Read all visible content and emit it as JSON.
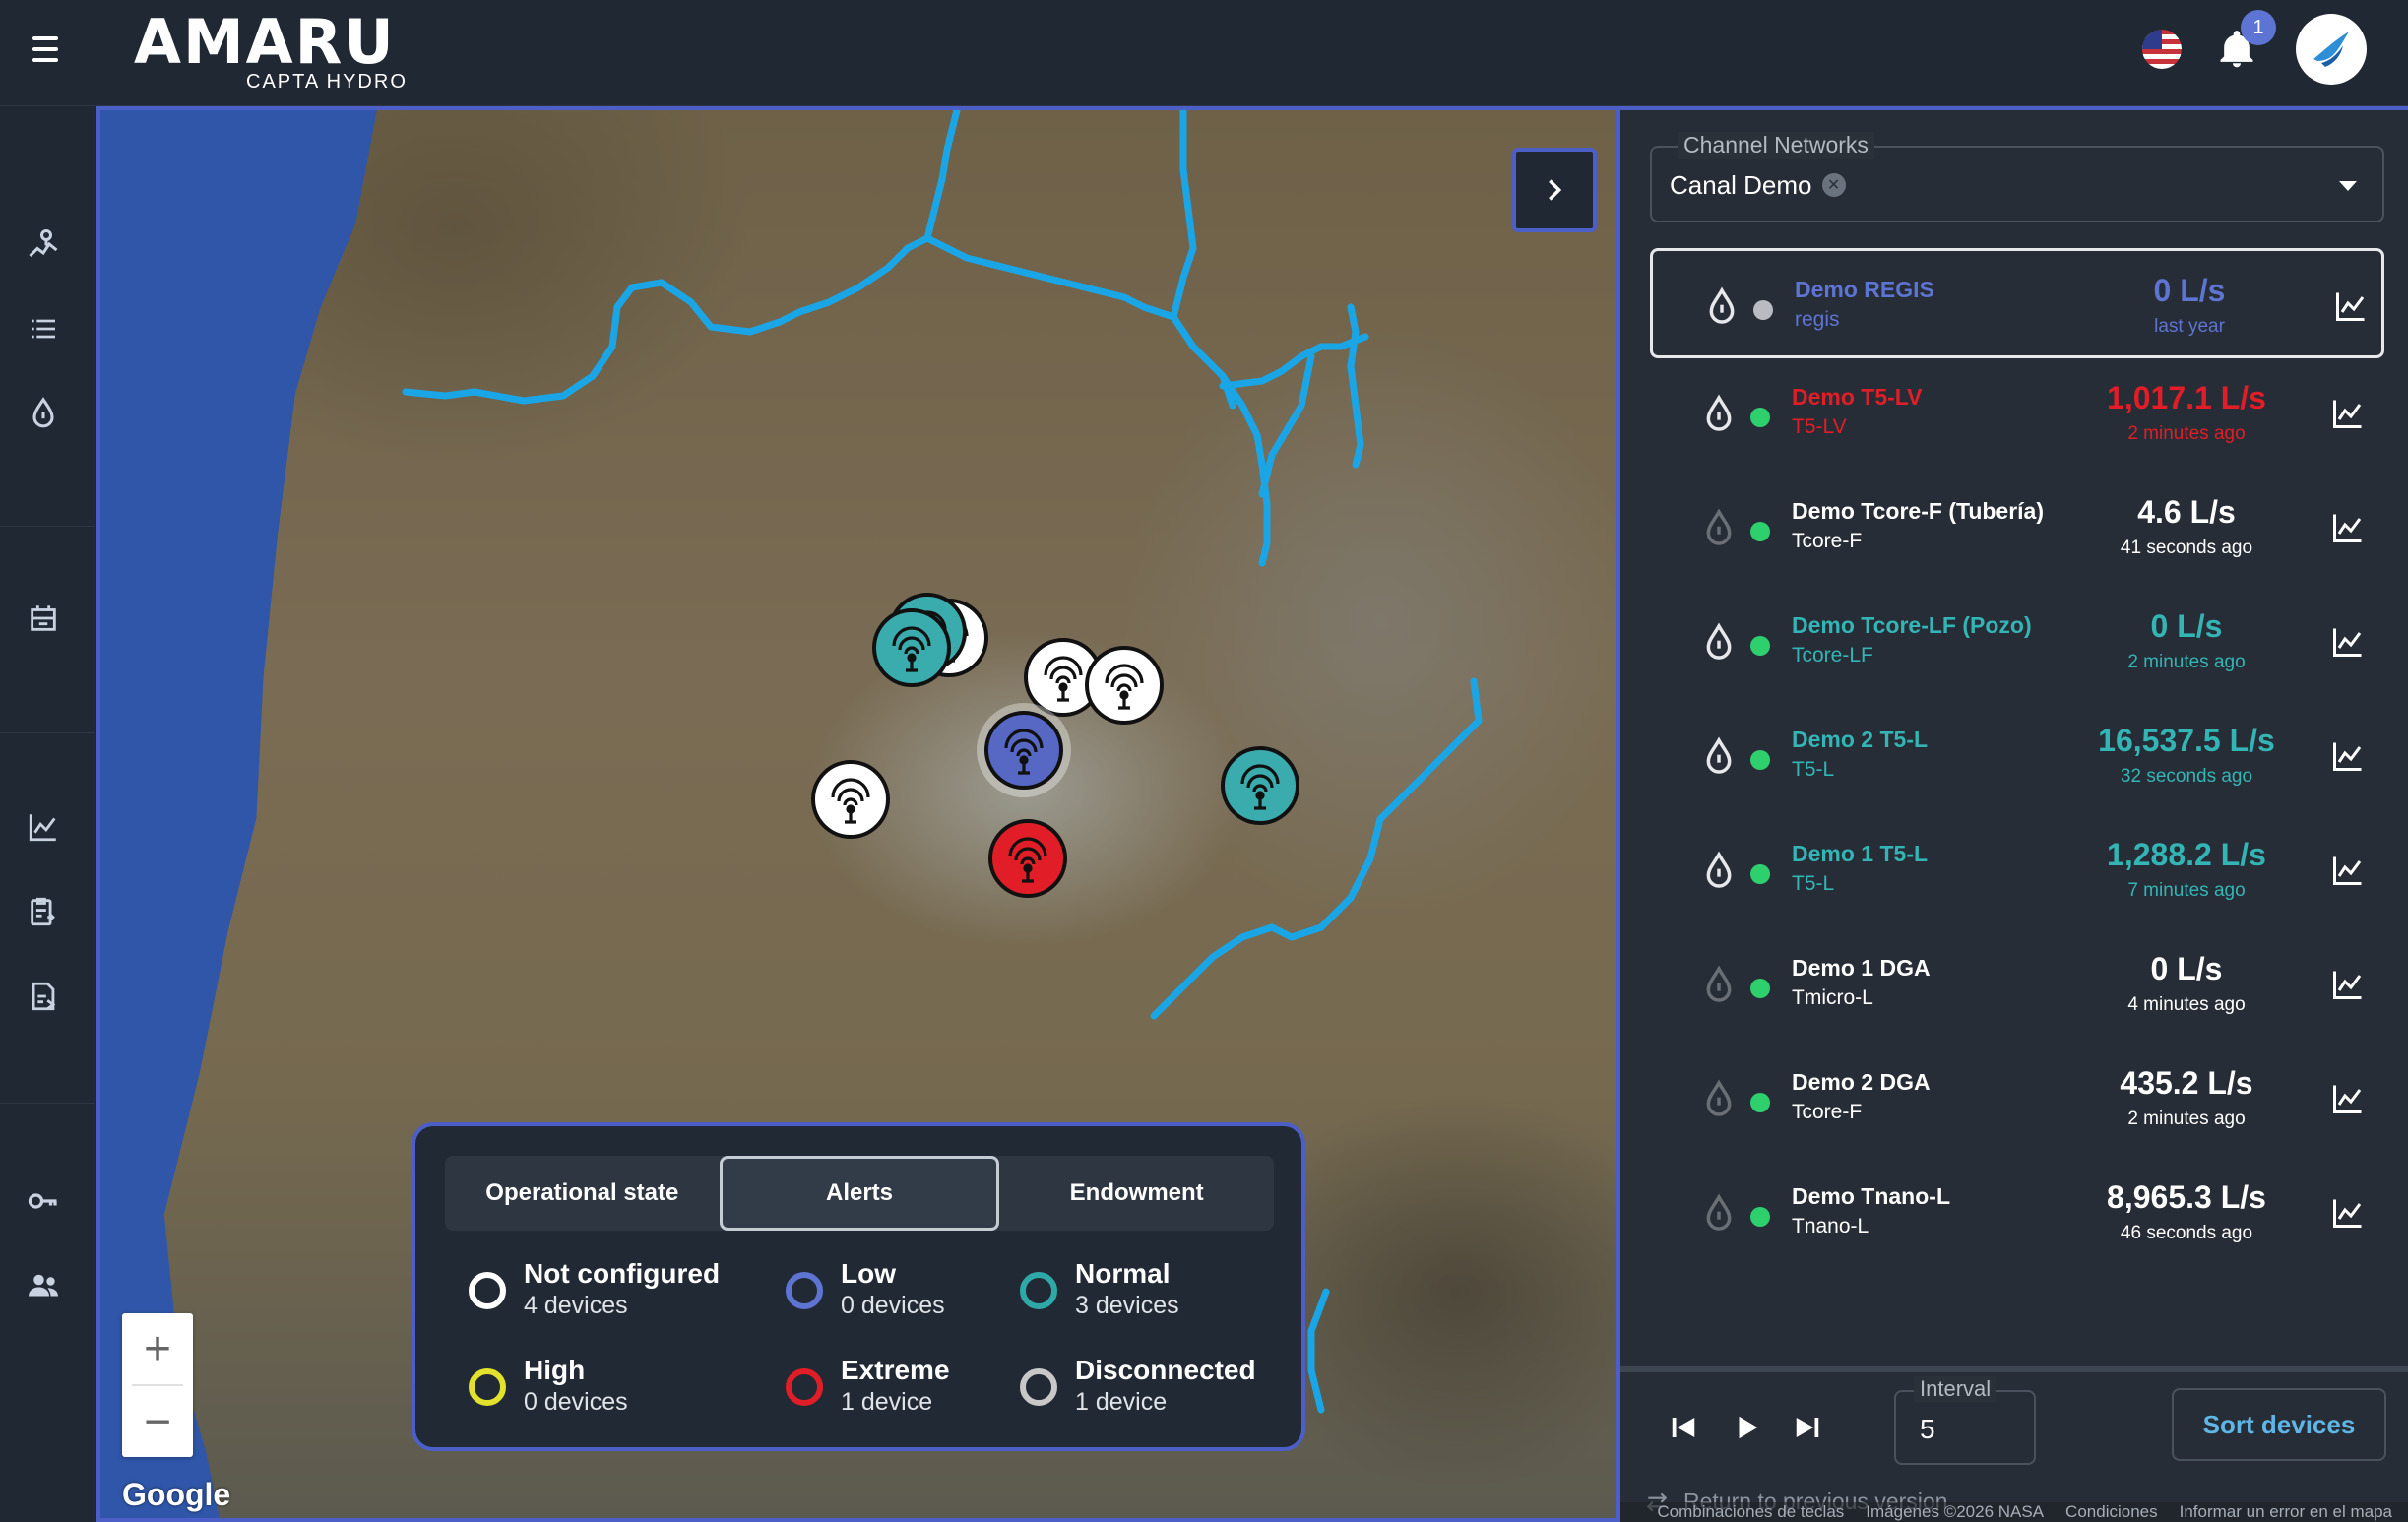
{
  "brand": {
    "name": "AMARU",
    "subtitle": "CAPTA HYDRO"
  },
  "header": {
    "notification_count": "1",
    "language_flag": "us-flag-icon"
  },
  "sidebar": {
    "items": [
      {
        "icon": "map-pin-icon"
      },
      {
        "icon": "list-icon"
      },
      {
        "icon": "water-drop-icon"
      },
      {
        "icon": "network-device-icon"
      },
      {
        "icon": "line-chart-icon"
      },
      {
        "icon": "clipboard-icon"
      },
      {
        "icon": "report-icon"
      },
      {
        "icon": "key-icon"
      },
      {
        "icon": "users-icon"
      }
    ]
  },
  "map": {
    "zoom_in": "+",
    "zoom_out": "−",
    "google_label": "Google"
  },
  "legend": {
    "tabs": [
      "Operational state",
      "Alerts",
      "Endowment"
    ],
    "active_tab": "Alerts",
    "items": [
      {
        "label": "Not configured",
        "count": "4 devices",
        "color": "#ffffff"
      },
      {
        "label": "Low",
        "count": "0 devices",
        "color": "#5d74d2"
      },
      {
        "label": "Normal",
        "count": "3 devices",
        "color": "#2fa9a8"
      },
      {
        "label": "High",
        "count": "0 devices",
        "color": "#e3e12c"
      },
      {
        "label": "Extreme",
        "count": "1 device",
        "color": "#e11e27"
      },
      {
        "label": "Disconnected",
        "count": "1 device",
        "color": "#c8c8c8"
      }
    ]
  },
  "panel": {
    "channel_label": "Channel Networks",
    "channel_value": "Canal Demo",
    "devices": [
      {
        "name": "Demo REGIS",
        "code": "regis",
        "value": "0 L/s",
        "time": "last year",
        "color": "#5d74d2",
        "status": "#b8bcc2",
        "selected": true
      },
      {
        "name": "Demo T5-LV",
        "code": "T5-LV",
        "value": "1,017.1 L/s",
        "time": "2 minutes ago",
        "color": "#e11e27",
        "status": "#2ed06e",
        "selected": false
      },
      {
        "name": "Demo Tcore-F (Tubería)",
        "code": "Tcore-F",
        "value": "4.6 L/s",
        "time": "41 seconds ago",
        "color": "#ffffff",
        "status": "#2ed06e",
        "selected": false
      },
      {
        "name": "Demo Tcore-LF (Pozo)",
        "code": "Tcore-LF",
        "value": "0 L/s",
        "time": "2 minutes ago",
        "color": "#34b5b5",
        "status": "#2ed06e",
        "selected": false
      },
      {
        "name": "Demo 2 T5-L",
        "code": "T5-L",
        "value": "16,537.5 L/s",
        "time": "32 seconds ago",
        "color": "#34b5b5",
        "status": "#2ed06e",
        "selected": false
      },
      {
        "name": "Demo 1 T5-L",
        "code": "T5-L",
        "value": "1,288.2 L/s",
        "time": "7 minutes ago",
        "color": "#34b5b5",
        "status": "#2ed06e",
        "selected": false
      },
      {
        "name": "Demo 1 DGA",
        "code": "Tmicro-L",
        "value": "0 L/s",
        "time": "4 minutes ago",
        "color": "#ffffff",
        "status": "#2ed06e",
        "selected": false
      },
      {
        "name": "Demo 2 DGA",
        "code": "Tcore-F",
        "value": "435.2 L/s",
        "time": "2 minutes ago",
        "color": "#ffffff",
        "status": "#2ed06e",
        "selected": false
      },
      {
        "name": "Demo Tnano-L",
        "code": "Tnano-L",
        "value": "8,965.3 L/s",
        "time": "46 seconds ago",
        "color": "#ffffff",
        "status": "#2ed06e",
        "selected": false
      }
    ],
    "interval_label": "Interval",
    "interval_value": "5",
    "sort_label": "Sort devices",
    "return_label": "Return to previous version",
    "attribution": [
      "Combinaciones de teclas",
      "Imágenes ©2026 NASA",
      "Condiciones",
      "Informar un error en el mapa"
    ]
  }
}
